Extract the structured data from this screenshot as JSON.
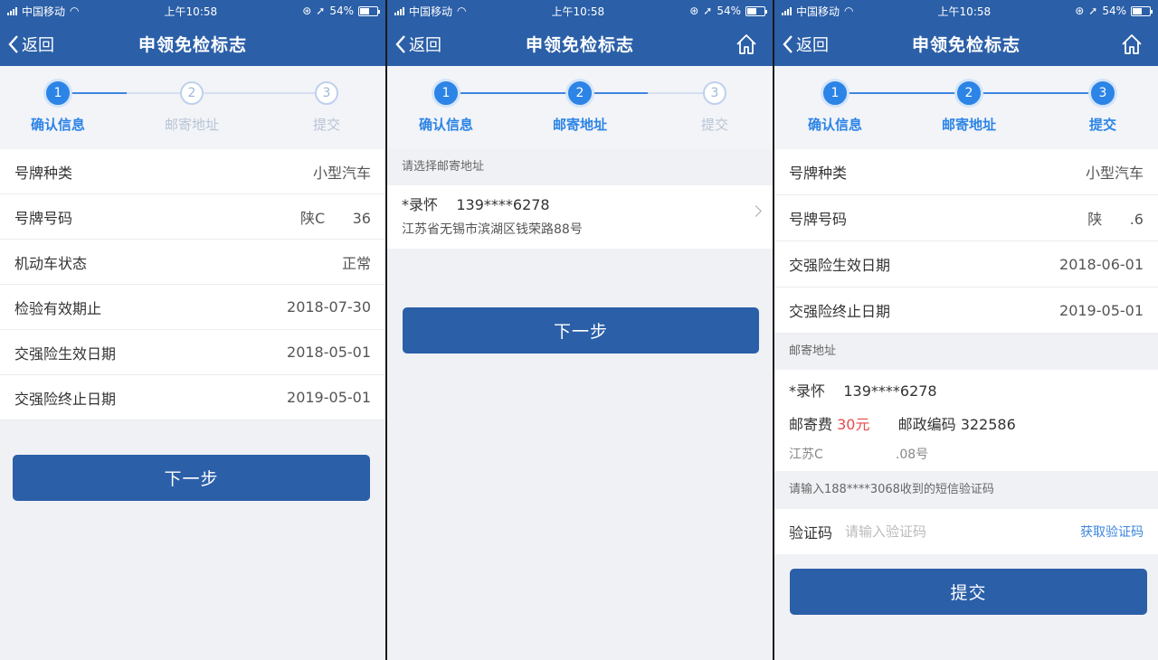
{
  "status": {
    "carrier": "中国移动",
    "time": "上午10:58",
    "battery": "54%",
    "battery_level": 0.54
  },
  "nav": {
    "title": "申领免检标志",
    "back_label": "返回"
  },
  "steps": [
    {
      "num": "1",
      "label": "确认信息"
    },
    {
      "num": "2",
      "label": "邮寄地址"
    },
    {
      "num": "3",
      "label": "提交"
    }
  ],
  "screen1": {
    "rows": [
      {
        "label": "号牌种类",
        "value": "小型汽车"
      },
      {
        "label": "号牌号码",
        "value": "陕C      36"
      },
      {
        "label": "机动车状态",
        "value": "正常"
      },
      {
        "label": "检验有效期止",
        "value": "2018-07-30"
      },
      {
        "label": "交强险生效日期",
        "value": "2018-05-01"
      },
      {
        "label": "交强险终止日期",
        "value": "2019-05-01"
      }
    ],
    "next_label": "下一步"
  },
  "screen2": {
    "section": "请选择邮寄地址",
    "address": {
      "name_phone": "*录怀    139****6278",
      "address": "江苏省无锡市滨湖区钱荣路88号"
    },
    "next_label": "下一步"
  },
  "screen3": {
    "rows": [
      {
        "label": "号牌种类",
        "value": "小型汽车"
      },
      {
        "label": "号牌号码",
        "value": "陕      .6"
      },
      {
        "label": "交强险生效日期",
        "value": "2018-06-01"
      },
      {
        "label": "交强险终止日期",
        "value": "2019-05-01"
      }
    ],
    "mail_section": "邮寄地址",
    "mail": {
      "name_phone": "*录怀    139****6278",
      "fee_label": "邮寄费",
      "fee": "30元",
      "zip_label": "邮政编码",
      "zip": "322586",
      "address": "江苏C                  .08号"
    },
    "sms_hint": "请输入188****3068收到的短信验证码",
    "code_label": "验证码",
    "code_placeholder": "请输入验证码",
    "get_code": "获取验证码",
    "submit_label": "提交"
  }
}
